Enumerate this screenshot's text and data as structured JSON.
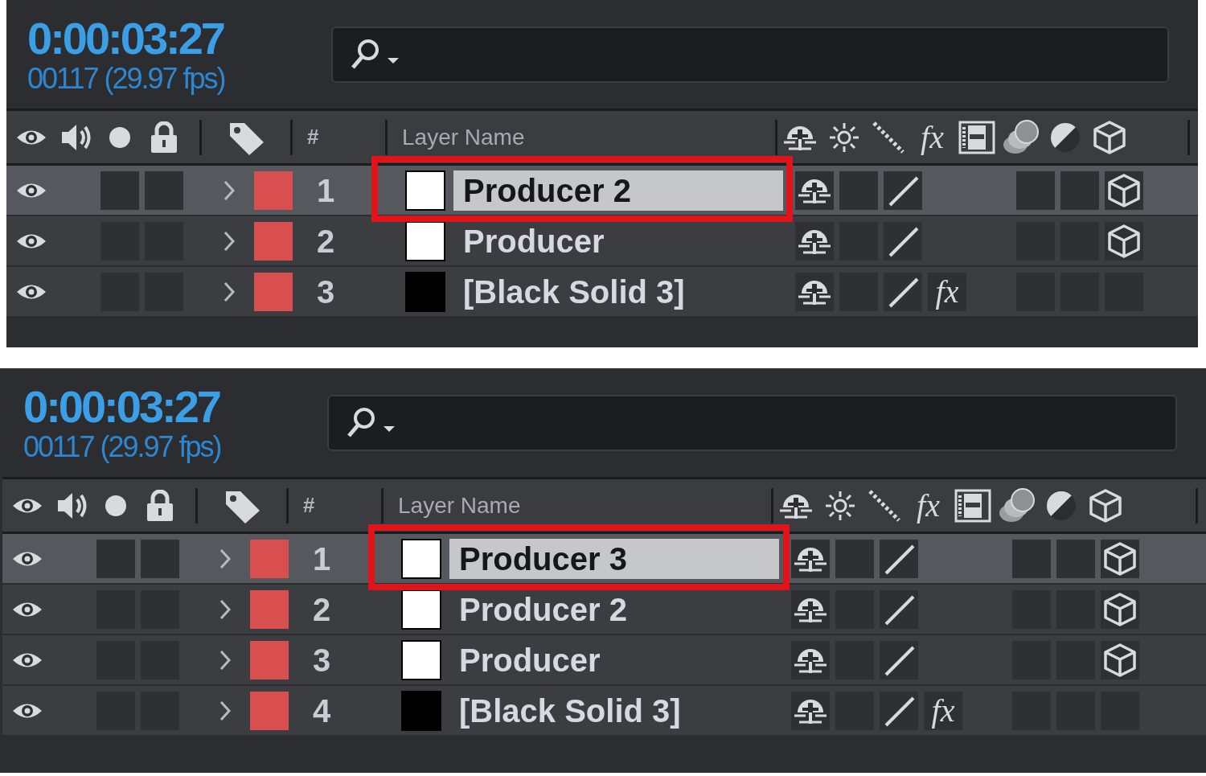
{
  "panels": [
    {
      "timecode": "0:00:03:27",
      "frames": "00117 (29.97 fps)",
      "header": {
        "number_label": "#",
        "name_label": "Layer Name",
        "fx_label": "fx"
      },
      "layers": [
        {
          "number": "1",
          "name": "Producer 2",
          "selected": true,
          "highlighted": true,
          "color": "#ffffff",
          "three_d": true
        },
        {
          "number": "2",
          "name": "Producer",
          "selected": false,
          "highlighted": false,
          "color": "#ffffff",
          "three_d": true
        },
        {
          "number": "3",
          "name": "[Black Solid 3]",
          "selected": false,
          "highlighted": false,
          "color": "#000000",
          "three_d": false,
          "fx": "fx"
        }
      ]
    },
    {
      "timecode": "0:00:03:27",
      "frames": "00117 (29.97 fps)",
      "header": {
        "number_label": "#",
        "name_label": "Layer Name",
        "fx_label": "fx"
      },
      "layers": [
        {
          "number": "1",
          "name": "Producer 3",
          "selected": true,
          "highlighted": true,
          "color": "#ffffff",
          "three_d": true
        },
        {
          "number": "2",
          "name": "Producer 2",
          "selected": false,
          "highlighted": false,
          "color": "#ffffff",
          "three_d": true
        },
        {
          "number": "3",
          "name": "Producer",
          "selected": false,
          "highlighted": false,
          "color": "#ffffff",
          "three_d": true
        },
        {
          "number": "4",
          "name": "[Black Solid 3]",
          "selected": false,
          "highlighted": false,
          "color": "#000000",
          "three_d": false,
          "fx": "fx"
        }
      ]
    }
  ]
}
